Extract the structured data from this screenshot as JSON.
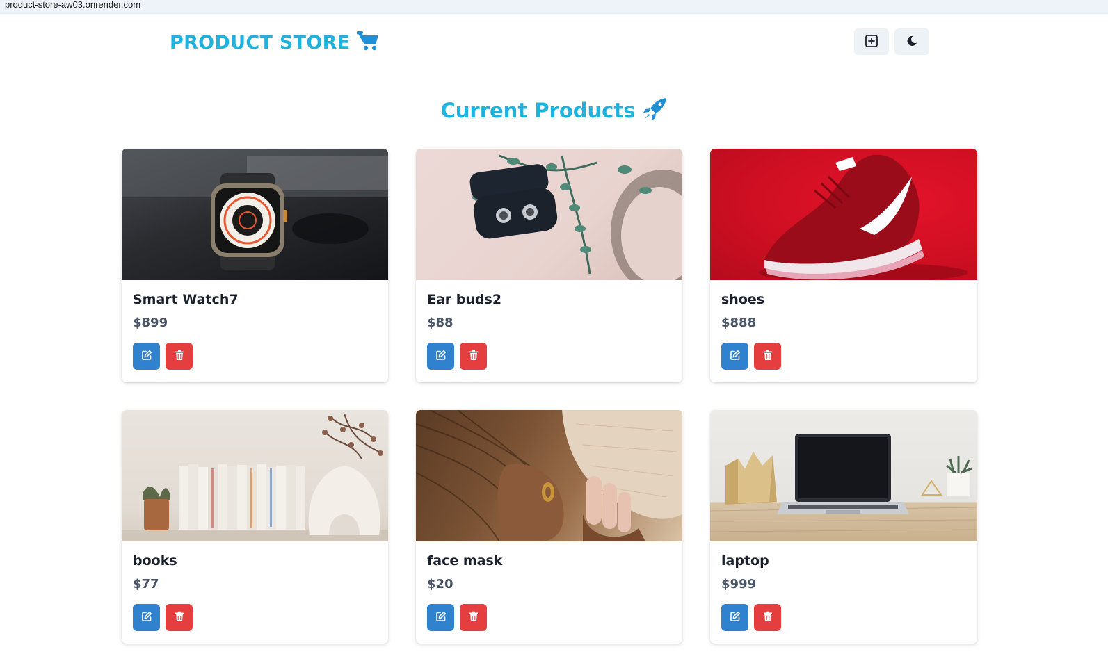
{
  "browser": {
    "url": "product-store-aw03.onrender.com"
  },
  "header": {
    "title": "PRODUCT STORE"
  },
  "page": {
    "heading": "Current Products"
  },
  "colors": {
    "accent": "#1fb2dd",
    "edit": "#3182ce",
    "delete": "#e53e3e"
  },
  "icons": {
    "brand": "shopping-cart-icon",
    "heading": "rocket-icon",
    "create": "plus-square-icon",
    "theme": "moon-icon",
    "edit": "edit-icon",
    "delete": "trash-icon"
  },
  "products": [
    {
      "name": "Smart Watch7",
      "price": "$899"
    },
    {
      "name": "Ear buds2",
      "price": "$88"
    },
    {
      "name": "shoes",
      "price": "$888"
    },
    {
      "name": "books",
      "price": "$77"
    },
    {
      "name": "face mask",
      "price": "$20"
    },
    {
      "name": "laptop",
      "price": "$999"
    }
  ]
}
